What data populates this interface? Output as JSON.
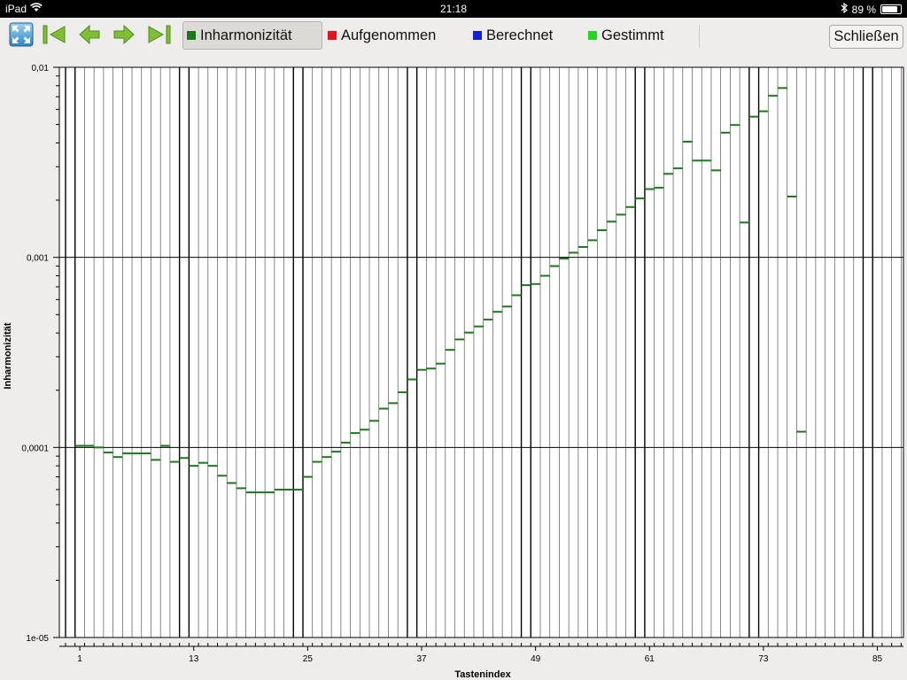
{
  "status_bar": {
    "device": "iPad",
    "time": "21:18",
    "battery": "89 %",
    "battery_level": 0.89
  },
  "toolbar": {
    "buttons": [
      {
        "name": "fullscreen-button",
        "icon": "expand-icon"
      },
      {
        "name": "first-button",
        "icon": "skip-first-icon"
      },
      {
        "name": "previous-button",
        "icon": "arrow-left-icon"
      },
      {
        "name": "next-button",
        "icon": "arrow-right-icon"
      },
      {
        "name": "last-button",
        "icon": "skip-last-icon"
      }
    ],
    "legend": [
      {
        "label": "Inharmonizität",
        "color": "#1a7a1a",
        "selected": true
      },
      {
        "label": "Aufgenommen",
        "color": "#e8141c",
        "selected": false
      },
      {
        "label": "Berechnet",
        "color": "#1020d8",
        "selected": false
      },
      {
        "label": "Gestimmt",
        "color": "#22d622",
        "selected": false
      }
    ],
    "close_label": "Schließen"
  },
  "chart_data": {
    "type": "scatter",
    "marker": "horizontal-dash",
    "xlabel": "Tastenindex",
    "ylabel": "Inharmonizität",
    "xlim": [
      0,
      88
    ],
    "x_ticks": [
      1,
      13,
      25,
      37,
      49,
      61,
      73,
      85
    ],
    "x_tick_labels": [
      "1",
      "13",
      "25",
      "37",
      "49",
      "61",
      "73",
      "85"
    ],
    "ylim": [
      1e-05,
      0.01
    ],
    "y_scale": "log",
    "y_ticks": [
      1e-05,
      0.0001,
      0.001,
      0.01
    ],
    "y_tick_labels": [
      "1e-05",
      "0,0001",
      "0,001",
      "0,01"
    ],
    "grid": true,
    "series": [
      {
        "color": "#1a7a1a",
        "points": [
          [
            1,
            0.000102
          ],
          [
            2,
            0.000102
          ],
          [
            3,
            0.0001
          ],
          [
            4,
            9.4e-05
          ],
          [
            5,
            8.9e-05
          ],
          [
            6,
            9.3e-05
          ],
          [
            7,
            9.3e-05
          ],
          [
            8,
            9.3e-05
          ],
          [
            9,
            8.6e-05
          ],
          [
            10,
            0.000102
          ],
          [
            11,
            8.4e-05
          ],
          [
            12,
            8.8e-05
          ],
          [
            13,
            8e-05
          ],
          [
            14,
            8.3e-05
          ],
          [
            15,
            8e-05
          ],
          [
            16,
            7.1e-05
          ],
          [
            17,
            6.5e-05
          ],
          [
            18,
            6.1e-05
          ],
          [
            19,
            5.8e-05
          ],
          [
            20,
            5.8e-05
          ],
          [
            21,
            5.8e-05
          ],
          [
            22,
            6e-05
          ],
          [
            23,
            6e-05
          ],
          [
            24,
            6e-05
          ],
          [
            25,
            7e-05
          ],
          [
            26,
            8.4e-05
          ],
          [
            27,
            8.9e-05
          ],
          [
            28,
            9.5e-05
          ],
          [
            29,
            0.000106
          ],
          [
            30,
            0.000119
          ],
          [
            31,
            0.000124
          ],
          [
            32,
            0.000138
          ],
          [
            33,
            0.00016
          ],
          [
            34,
            0.000171
          ],
          [
            35,
            0.000195
          ],
          [
            36,
            0.000228
          ],
          [
            37,
            0.000256
          ],
          [
            38,
            0.00026
          ],
          [
            39,
            0.000276
          ],
          [
            40,
            0.000326
          ],
          [
            41,
            0.00037
          ],
          [
            42,
            0.000402
          ],
          [
            43,
            0.000433
          ],
          [
            44,
            0.000471
          ],
          [
            45,
            0.000517
          ],
          [
            46,
            0.000551
          ],
          [
            47,
            0.000632
          ],
          [
            48,
            0.000714
          ],
          [
            49,
            0.000724
          ],
          [
            50,
            0.0008
          ],
          [
            51,
            0.0009
          ],
          [
            52,
            0.000986
          ],
          [
            53,
            0.001058
          ],
          [
            54,
            0.001134
          ],
          [
            55,
            0.00123
          ],
          [
            56,
            0.00139
          ],
          [
            57,
            0.001542
          ],
          [
            58,
            0.001678
          ],
          [
            59,
            0.00184
          ],
          [
            60,
            0.002042
          ],
          [
            61,
            0.002287
          ],
          [
            62,
            0.002323
          ],
          [
            63,
            0.00275
          ],
          [
            64,
            0.00294
          ],
          [
            65,
            0.00406
          ],
          [
            66,
            0.00323
          ],
          [
            67,
            0.00323
          ],
          [
            68,
            0.00287
          ],
          [
            69,
            0.00453
          ],
          [
            70,
            0.00497
          ],
          [
            71,
            0.001525
          ],
          [
            72,
            0.0055
          ],
          [
            73,
            0.00587
          ],
          [
            74,
            0.00708
          ],
          [
            75,
            0.00778
          ],
          [
            76,
            0.00209
          ],
          [
            77,
            0.000121
          ]
        ]
      }
    ]
  }
}
